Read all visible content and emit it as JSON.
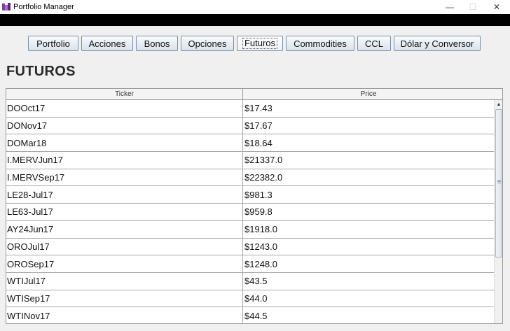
{
  "window": {
    "title": "Portfolio Manager",
    "icons": {
      "app": "portfolio-app-icon",
      "minimize": "minimize-icon",
      "maximize": "maximize-icon",
      "close": "close-icon"
    }
  },
  "nav": {
    "buttons": [
      {
        "label": "Portfolio"
      },
      {
        "label": "Acciones"
      },
      {
        "label": "Bonos"
      },
      {
        "label": "Opciones"
      },
      {
        "label": "Futuros",
        "active": true
      },
      {
        "label": "Commodities"
      },
      {
        "label": "CCL"
      },
      {
        "label": "Dólar y Conversor"
      }
    ]
  },
  "page": {
    "title": "FUTUROS"
  },
  "table": {
    "columns": [
      "Ticker",
      "Price"
    ],
    "rows": [
      [
        "DOOct17",
        "$17.43"
      ],
      [
        "DONov17",
        "$17.67"
      ],
      [
        "DOMar18",
        "$18.64"
      ],
      [
        "I.MERVJun17",
        "$21337.0"
      ],
      [
        "I.MERVSep17",
        "$22382.0"
      ],
      [
        "LE28-Jul17",
        "$981.3"
      ],
      [
        "LE63-Jul17",
        "$959.8"
      ],
      [
        "AY24Jun17",
        "$1918.0"
      ],
      [
        "OROJul17",
        "$1243.0"
      ],
      [
        "OROSep17",
        "$1248.0"
      ],
      [
        "WTIJul17",
        "$43.5"
      ],
      [
        "WTISep17",
        "$44.0"
      ],
      [
        "WTINov17",
        "$44.5"
      ]
    ],
    "scroll_up_icon": "scroll-up-arrow-icon"
  },
  "colors": {
    "titlebar_band": "#000000",
    "button_border": "#7a8ea5",
    "grid": "#a8a8a8"
  }
}
